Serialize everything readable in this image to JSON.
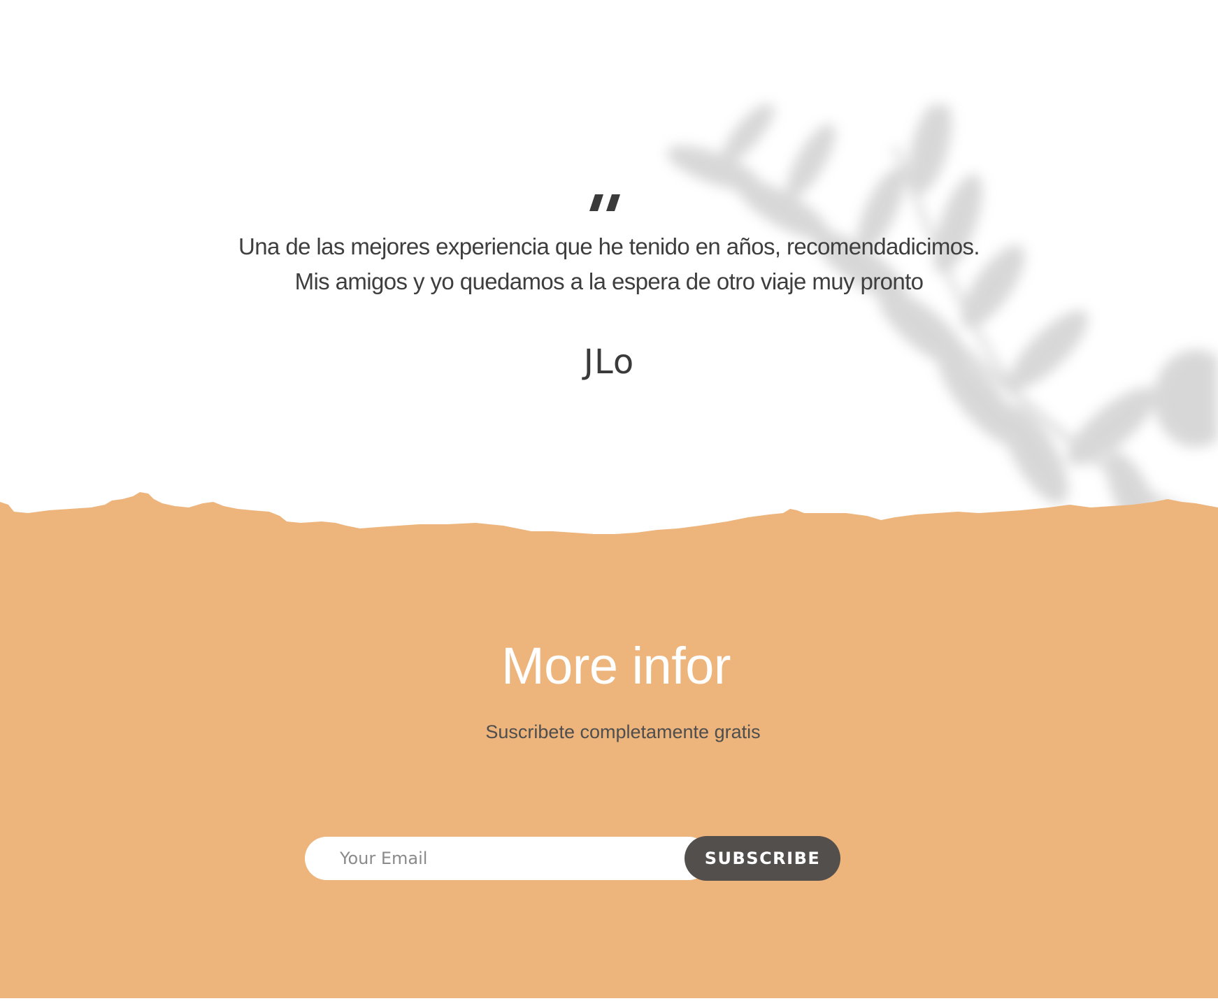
{
  "colors": {
    "background": "#ffffff",
    "accent_orange": "#edb47c",
    "text_dark": "#3e3e3e",
    "button_dark": "#524f4c",
    "heading_light": "#ffffff"
  },
  "testimonial": {
    "quote_icon": "quote-icon",
    "line1": "Una de las mejores experiencia que he tenido en años, recomendadicimos.",
    "line2": "Mis amigos y yo quedamos a la espera de otro viaje muy pronto",
    "author": "JLo"
  },
  "newsletter": {
    "title": "More infor",
    "subtitle": "Suscribete completamente gratis",
    "email_placeholder": "Your Email",
    "email_value": "",
    "button_label": "SUBSCRIBE"
  }
}
